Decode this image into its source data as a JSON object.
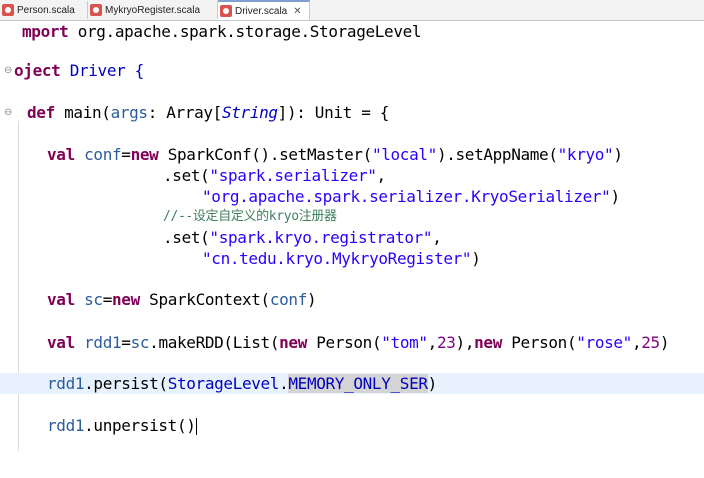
{
  "tabs": [
    {
      "label": "Person.scala",
      "active": false
    },
    {
      "label": "MykryoRegister.scala",
      "active": false
    },
    {
      "label": "Driver.scala",
      "active": true
    }
  ],
  "code": {
    "l1_kw": "mport",
    "l1_rest": " org.apache.spark.storage.StorageLevel",
    "l2_kw": "oject",
    "l2_name": " Driver {",
    "l3_kw": "def",
    "l3_a": " main(",
    "l3_param": "args",
    "l3_b": ": Array[",
    "l3_type": "String",
    "l3_c": "]): Unit = {",
    "l4_kw": "val",
    "l4_var": " conf",
    "l4_a": "=",
    "l4_new": "new",
    "l4_b": " SparkConf().setMaster(",
    "l4_s1": "\"local\"",
    "l4_c": ").setAppName(",
    "l4_s2": "\"kryo\"",
    "l4_d": ")",
    "l5_a": ".set(",
    "l5_s": "\"spark.serializer\"",
    "l5_b": ",",
    "l6_s": "\"org.apache.spark.serializer.KryoSerializer\"",
    "l6_b": ")",
    "l7_comment": "//--设定自定义的kryo注册器",
    "l8_a": ".set(",
    "l8_s": "\"spark.kryo.registrator\"",
    "l8_b": ",",
    "l9_s": "\"cn.tedu.kryo.MykryoRegister\"",
    "l9_b": ")",
    "l10_kw": "val",
    "l10_var": " sc",
    "l10_a": "=",
    "l10_new": "new",
    "l10_b": " SparkContext(",
    "l10_param": "conf",
    "l10_c": ")",
    "l11_kw": "val",
    "l11_var": " rdd1",
    "l11_a": "=",
    "l11_sc": "sc",
    "l11_b": ".makeRDD(List(",
    "l11_new1": "new",
    "l11_c": " Person(",
    "l11_s1": "\"tom\"",
    "l11_d": ",",
    "l11_n1": "23",
    "l11_e": "),",
    "l11_new2": "new",
    "l11_f": " Person(",
    "l11_s2": "\"rose\"",
    "l11_g": ",",
    "l11_n2": "25",
    "l11_h": ")",
    "l12_var": "rdd1",
    "l12_a": ".persist(",
    "l12_obj": "StorageLevel",
    "l12_dot": ".",
    "l12_hl": "MEMORY_ONLY_SER",
    "l12_b": ")",
    "l13_var": "rdd1",
    "l13_a": ".unpersist()"
  },
  "colors": {
    "keyword": "#7f0055",
    "string": "#2a00ff",
    "comment": "#3f7f5f",
    "current_line": "#e8f2fe"
  }
}
